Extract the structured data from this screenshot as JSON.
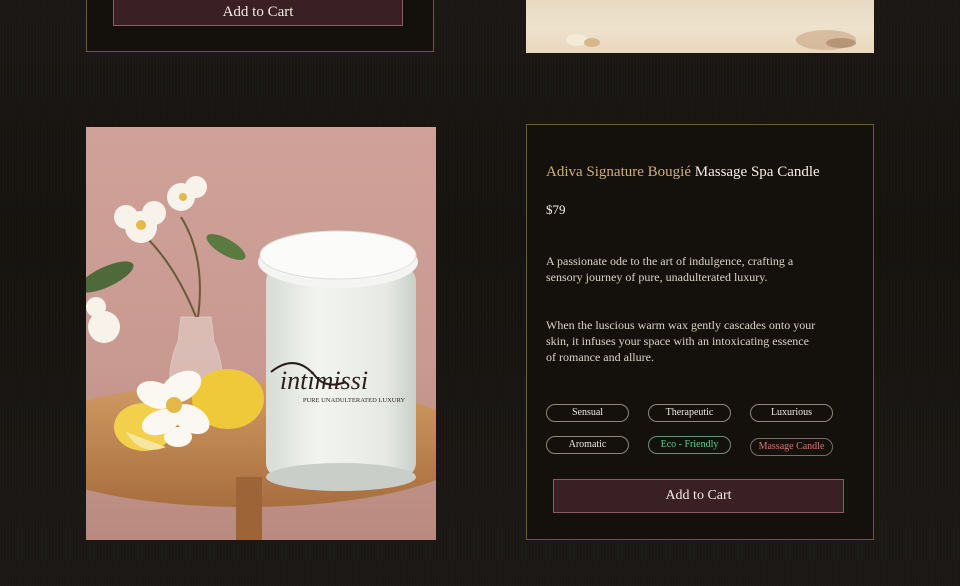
{
  "top_card": {
    "cart_label": "Add to Cart"
  },
  "product": {
    "brand": "Adiva Signature Bougié",
    "name": "Massage Spa Candle",
    "price": "$79",
    "description": [
      "A passionate ode to the art of indulgence, crafting a sensory journey of pure, unadulterated luxury.",
      "When the luscious warm wax gently cascades onto your skin, it infuses your space with an intoxicating essence of romance and allure."
    ],
    "image_text": {
      "logo": "intimissi",
      "tagline": "PURE UNADULTERATED LUXURY"
    },
    "tags": [
      "Sensual",
      "Therapeutic",
      "Luxurious",
      "Aromatic",
      "Eco - Friendly",
      "Massage Candle"
    ],
    "cart_label": "Add to Cart"
  },
  "colors": {
    "accent_gold": "#d2b071",
    "button_bg": "#3a1f24",
    "eco_green": "#58d08a",
    "massage_red": "#d9766f"
  }
}
